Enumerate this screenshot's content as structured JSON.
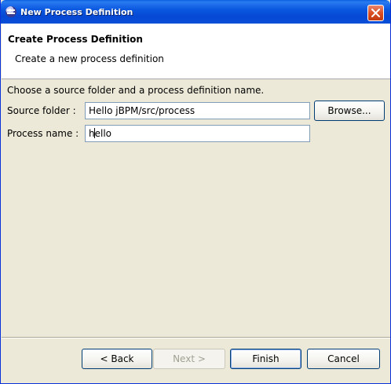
{
  "window": {
    "title": "New Process Definition"
  },
  "header": {
    "title": "Create Process Definition",
    "description": "Create a new process definition"
  },
  "form": {
    "instruction": "Choose a source folder and a process definition name.",
    "source_folder_label": "Source folder :",
    "source_folder_value": "Hello jBPM/src/process",
    "browse_label": "Browse...",
    "process_name_label": "Process name :",
    "process_name_value_before_caret": "h",
    "process_name_value_after_caret": "ello"
  },
  "footer": {
    "back_label": "< Back",
    "next_label": "Next >",
    "finish_label": "Finish",
    "cancel_label": "Cancel"
  },
  "icons": {
    "app": "eclipse-icon",
    "close": "close-icon"
  },
  "colors": {
    "titlebar": "#0548d4",
    "dialog_bg": "#ece9d8",
    "close_button": "#d94b1e",
    "disabled_text": "#a1a192"
  }
}
